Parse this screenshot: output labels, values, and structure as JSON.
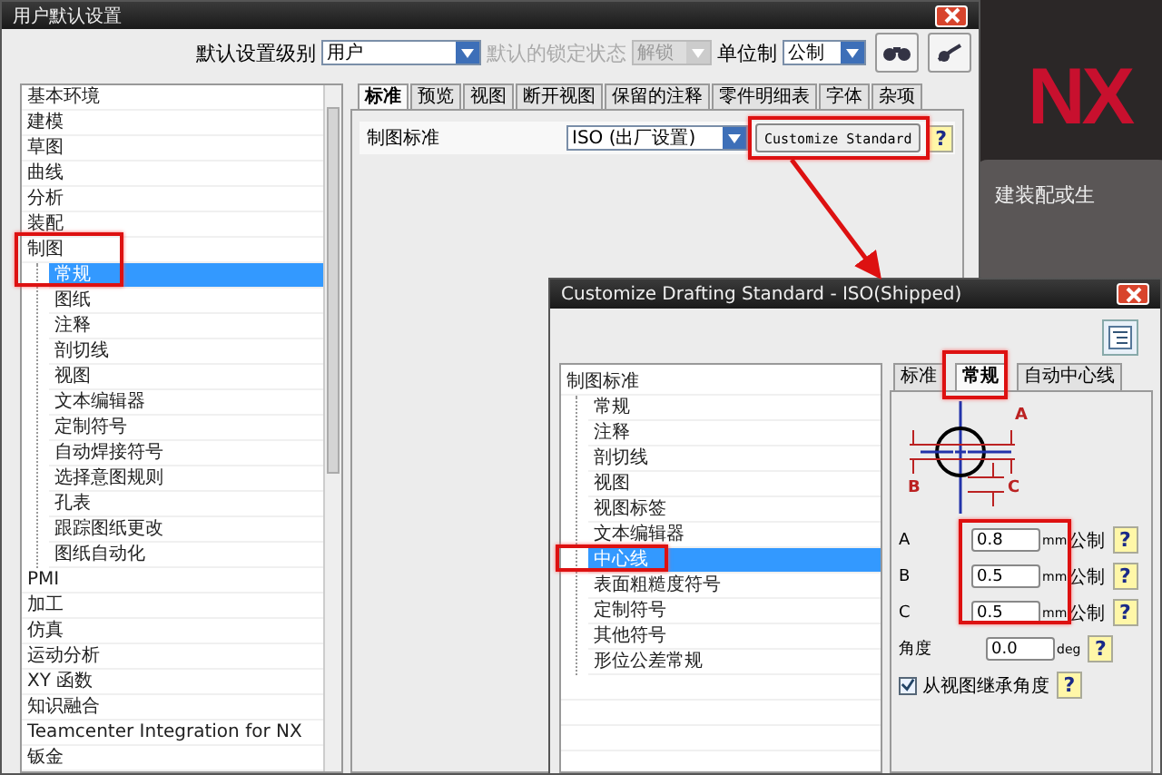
{
  "main_window": {
    "title": "用户默认设置",
    "toolbar": {
      "level_label": "默认设置级别",
      "level_value": "用户",
      "lock_label": "默认的锁定状态",
      "lock_value": "解锁",
      "lock_disabled": true,
      "unit_label": "单位制",
      "unit_value": "公制"
    },
    "tree": [
      {
        "label": "基本环境",
        "selected": false
      },
      {
        "label": "建模",
        "selected": false
      },
      {
        "label": "草图",
        "selected": false
      },
      {
        "label": "曲线",
        "selected": false
      },
      {
        "label": "分析",
        "selected": false
      },
      {
        "label": "装配",
        "selected": false
      },
      {
        "label": "制图",
        "selected": false,
        "children": [
          {
            "label": "常规",
            "selected": true
          },
          {
            "label": "图纸",
            "selected": false
          },
          {
            "label": "注释",
            "selected": false
          },
          {
            "label": "剖切线",
            "selected": false
          },
          {
            "label": "视图",
            "selected": false
          },
          {
            "label": "文本编辑器",
            "selected": false
          },
          {
            "label": "定制符号",
            "selected": false
          },
          {
            "label": "自动焊接符号",
            "selected": false
          },
          {
            "label": "选择意图规则",
            "selected": false
          },
          {
            "label": "孔表",
            "selected": false
          },
          {
            "label": "跟踪图纸更改",
            "selected": false
          },
          {
            "label": "图纸自动化",
            "selected": false
          }
        ]
      },
      {
        "label": "PMI",
        "selected": false
      },
      {
        "label": "加工",
        "selected": false
      },
      {
        "label": "仿真",
        "selected": false
      },
      {
        "label": "运动分析",
        "selected": false
      },
      {
        "label": "XY 函数",
        "selected": false
      },
      {
        "label": "知识融合",
        "selected": false
      },
      {
        "label": "Teamcenter Integration for NX",
        "selected": false
      },
      {
        "label": "钣金",
        "selected": false
      }
    ],
    "tabs": [
      {
        "label": "标准",
        "selected": true
      },
      {
        "label": "预览",
        "selected": false
      },
      {
        "label": "视图",
        "selected": false
      },
      {
        "label": "断开视图",
        "selected": false
      },
      {
        "label": "保留的注释",
        "selected": false
      },
      {
        "label": "零件明细表",
        "selected": false
      },
      {
        "label": "字体",
        "selected": false
      },
      {
        "label": "杂项",
        "selected": false
      }
    ],
    "standard_row": {
      "label": "制图标准",
      "value": "ISO (出厂设置)",
      "button": "Customize Standard",
      "help": "?"
    }
  },
  "background": {
    "logo": "NX",
    "card_text": "建装配或生"
  },
  "dialog": {
    "title": "Customize Drafting Standard - ISO(Shipped)",
    "tree": [
      {
        "label": "制图标准",
        "selected": false,
        "children": [
          {
            "label": "常规",
            "selected": false
          },
          {
            "label": "注释",
            "selected": false
          },
          {
            "label": "剖切线",
            "selected": false
          },
          {
            "label": "视图",
            "selected": false
          },
          {
            "label": "视图标签",
            "selected": false
          },
          {
            "label": "文本编辑器",
            "selected": false
          },
          {
            "label": "中心线",
            "selected": true
          },
          {
            "label": "表面粗糙度符号",
            "selected": false
          },
          {
            "label": "定制符号",
            "selected": false
          },
          {
            "label": "其他符号",
            "selected": false
          },
          {
            "label": "形位公差常规",
            "selected": false
          }
        ]
      }
    ],
    "tabs": [
      {
        "label": "标准",
        "selected": false
      },
      {
        "label": "常规",
        "selected": true
      },
      {
        "label": "自动中心线",
        "selected": false
      }
    ],
    "diagram_labels": [
      "A",
      "B",
      "C"
    ],
    "fields": [
      {
        "label": "A",
        "value": "0.8",
        "unit": "mm",
        "system": "公制",
        "help": "?"
      },
      {
        "label": "B",
        "value": "0.5",
        "unit": "mm",
        "system": "公制",
        "help": "?"
      },
      {
        "label": "C",
        "value": "0.5",
        "unit": "mm",
        "system": "公制",
        "help": "?"
      }
    ],
    "angle": {
      "label": "角度",
      "value": "0.0",
      "unit": "deg",
      "help": "?"
    },
    "checkbox": {
      "label": "从视图继承角度",
      "checked": true,
      "help": "?"
    }
  }
}
